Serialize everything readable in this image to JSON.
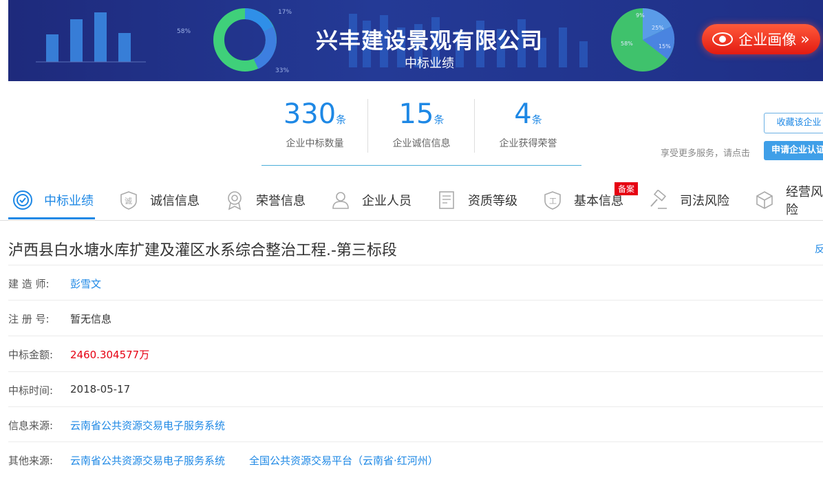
{
  "banner": {
    "company_name": "兴丰建设景观有限公司",
    "subtitle": "中标业绩",
    "portrait_button": "企业画像",
    "deco_donut_labels": [
      "17%",
      "58%",
      "33%"
    ],
    "deco_pie_labels": [
      "9%",
      "25%",
      "58%",
      "15%"
    ]
  },
  "stats": [
    {
      "value": "330",
      "unit": "条",
      "label": "企业中标数量"
    },
    {
      "value": "15",
      "unit": "条",
      "label": "企业诚信信息"
    },
    {
      "value": "4",
      "unit": "条",
      "label": "企业获得荣誉"
    }
  ],
  "actions": {
    "favorite": "收藏该企业",
    "enjoy_text": "享受更多服务，请点击",
    "apply": "申请企业认证"
  },
  "tabs": [
    {
      "label": "中标业绩",
      "icon": "target-check-icon",
      "active": true
    },
    {
      "label": "诚信信息",
      "icon": "shield-integrity-icon"
    },
    {
      "label": "荣誉信息",
      "icon": "medal-icon"
    },
    {
      "label": "企业人员",
      "icon": "person-icon"
    },
    {
      "label": "资质等级",
      "icon": "certificate-doc-icon"
    },
    {
      "label": "基本信息",
      "icon": "shield-work-icon"
    },
    {
      "label": "司法风险",
      "icon": "gavel-icon"
    },
    {
      "label": "经营风险",
      "icon": "cube-icon"
    }
  ],
  "record_badge": "备案",
  "project": {
    "title": "泸西县白水塘水库扩建及灌区水系综合整治工程.-第三标段",
    "feedback": "反",
    "fields": [
      {
        "label": "建 造 师:",
        "value": "彭雪文"
      },
      {
        "label": "注 册 号:",
        "value": "暂无信息"
      },
      {
        "label": "中标金额:",
        "value": "2460.304577万"
      },
      {
        "label": "中标时间:",
        "value": "2018-05-17"
      },
      {
        "label": "信息来源:",
        "value": "云南省公共资源交易电子服务系统"
      },
      {
        "label": "其他来源:",
        "value": "云南省公共资源交易电子服务系统",
        "value2": "全国公共资源交易平台（云南省·红河州）"
      }
    ]
  },
  "colors": {
    "accent": "#1e88e5",
    "banner": "#23338c",
    "danger": "#e60012"
  }
}
